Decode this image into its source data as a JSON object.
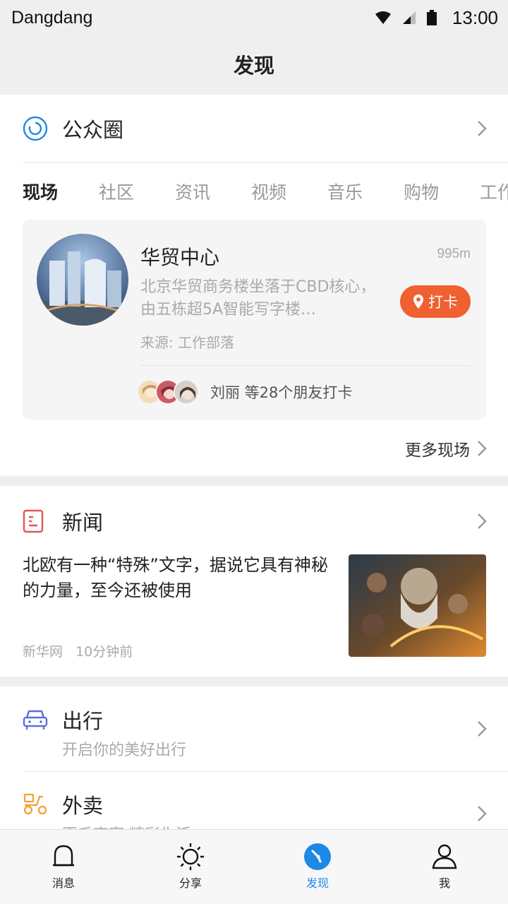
{
  "status_bar": {
    "carrier": "Dangdang",
    "time": "13:00"
  },
  "nav": {
    "title": "发现"
  },
  "moments": {
    "title": "公众圈"
  },
  "tabs": [
    "现场",
    "社区",
    "资讯",
    "视频",
    "音乐",
    "购物",
    "工作"
  ],
  "scene": {
    "name": "华贸中心",
    "distance": "995m",
    "description": "北京华贸商务楼坐落于CBD核心，由五栋超5A智能写字楼…",
    "source": "来源: 工作部落",
    "checkin_label": "打卡",
    "friends_text": "刘丽 等28个朋友打卡"
  },
  "more_scenes": "更多现场",
  "news": {
    "title": "新闻",
    "headline": "北欧有一种“特殊”文字，据说它具有神秘的力量，至今还被使用",
    "publisher": "新华网",
    "time": "10分钟前"
  },
  "services": [
    {
      "title": "出行",
      "subtitle": "开启你的美好出行",
      "icon": "car-icon"
    },
    {
      "title": "外卖",
      "subtitle": "百千商家 精彩生活",
      "icon": "delivery-scooter-icon"
    }
  ],
  "tab_bar": [
    {
      "label": "消息",
      "icon": "bell-icon"
    },
    {
      "label": "分享",
      "icon": "sun-icon"
    },
    {
      "label": "发现",
      "icon": "compass-icon"
    },
    {
      "label": "我",
      "icon": "person-icon"
    }
  ],
  "colors": {
    "accent": "#1e88e5",
    "checkin": "#f06030",
    "news_icon": "#e0575a",
    "car_icon": "#5a6fd8",
    "delivery_icon": "#f0a030"
  }
}
